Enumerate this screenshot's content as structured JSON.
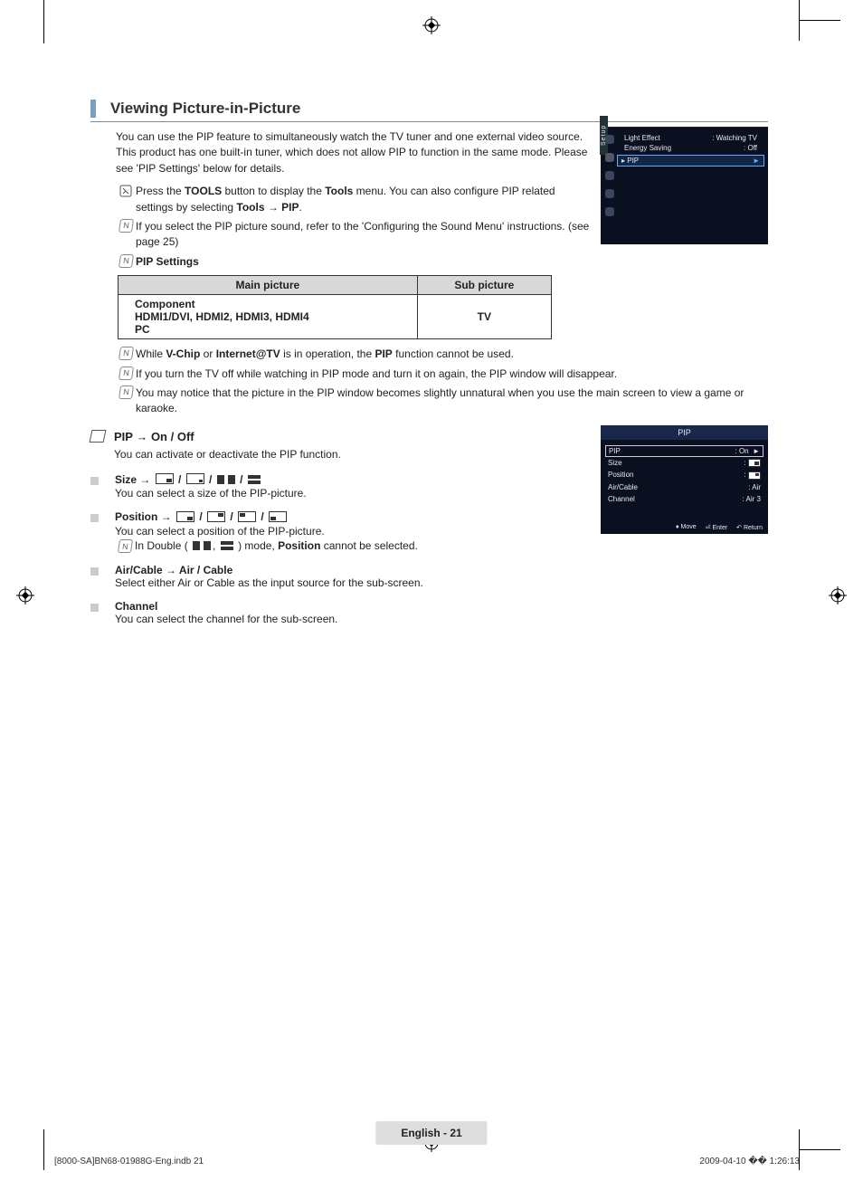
{
  "section_title": "Viewing Picture-in-Picture",
  "intro": "You can use the PIP feature to simultaneously watch the TV tuner and one external video source. This product has one built-in tuner, which does not allow PIP to function in the same mode. Please see 'PIP Settings' below for details.",
  "tools_note": {
    "p1a": "Press the ",
    "p1b": "TOOLS",
    "p1c": " button to display the ",
    "p1d": "Tools",
    "p1e": " menu. You can also configure PIP related settings by selecting ",
    "p1f": "Tools → PIP",
    "p1g": "."
  },
  "sound_note": "If you select the PIP picture sound, refer to the 'Configuring the Sound Menu' instructions. (see page 25)",
  "pip_settings_label": "PIP Settings",
  "table": {
    "h1": "Main picture",
    "h2": "Sub picture",
    "r1": "Component",
    "r2": "HDMI1/DVI, HDMI2, HDMI3, HDMI4",
    "r3": "PC",
    "sub": "TV"
  },
  "note_vchip": {
    "a": "While ",
    "b": "V-Chip",
    "c": " or ",
    "d": "Internet@TV",
    "e": " is in operation, the ",
    "f": "PIP",
    "g": " function cannot be used."
  },
  "note_off": "If you turn the TV off while watching in PIP mode and turn it on again, the PIP window will disappear.",
  "note_unnatural": "You may notice that the picture in the PIP window becomes slightly unnatural when you use the main screen to view a game or karaoke.",
  "pip_onoff": {
    "title": "PIP → On / Off",
    "body": "You can activate or deactivate the PIP function."
  },
  "size": {
    "prefix": "Size → ",
    "body": "You can select a size of the PIP-picture."
  },
  "position": {
    "prefix": "Position → ",
    "body": "You can select a position of the PIP-picture.",
    "double_a": "In Double (",
    "double_b": ") mode, ",
    "double_c": "Position",
    "double_d": " cannot be selected."
  },
  "aircable": {
    "title": "Air/Cable → Air / Cable",
    "body": "Select either Air or Cable as the input source for the sub-screen."
  },
  "channel": {
    "title": "Channel",
    "body": "You can select the channel for the sub-screen."
  },
  "osd1": {
    "setup": "Setup",
    "r1l": "Light Effect",
    "r1r": ": Watching TV",
    "r2l": "Energy Saving",
    "r2r": ": Off",
    "r3l": "PIP",
    "arrow": "►"
  },
  "osd2": {
    "title": "PIP",
    "r1l": "PIP",
    "r1r": ": On",
    "r2l": "Size",
    "r3l": "Position",
    "r4l": "Air/Cable",
    "r4r": ": Air",
    "r5l": "Channel",
    "r5r": ": Air 3",
    "f1": "Move",
    "f2": "Enter",
    "f3": "Return"
  },
  "footer": "English - 21",
  "print": {
    "left": "[8000-SA]BN68-01988G-Eng.indb   21",
    "right": "2009-04-10   �� 1:26:13"
  }
}
